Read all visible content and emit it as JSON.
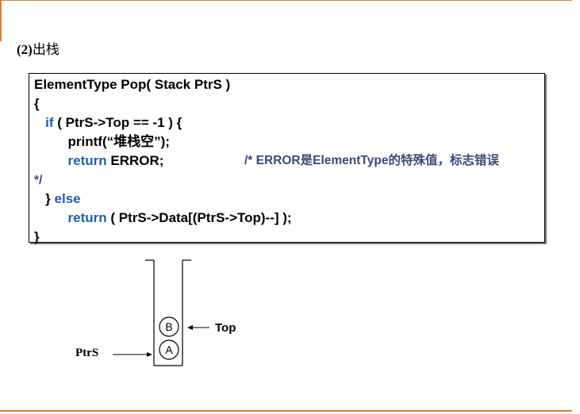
{
  "heading": {
    "number": "(2)",
    "text": "出栈"
  },
  "code": {
    "line1": "ElementType Pop( Stack PtrS )",
    "line2": "{",
    "line3_kw": "if",
    "line3_rest": " ( PtrS->Top == -1 ) {",
    "line4": "printf(“堆栈空”);",
    "line5_kw": "return",
    "line5_rest": " ERROR;",
    "line5_comment": "/* ERROR是ElementType的特殊值，标志错误",
    "line6": "*/",
    "line7_brace": "} ",
    "line7_kw": "else",
    "line8_kw": "return",
    "line8_rest": " ( PtrS->Data[(PtrS->Top)--] );",
    "line9": "}"
  },
  "diagram": {
    "top_label": "Top",
    "ptrs_label": "PtrS",
    "nodes": [
      "B",
      "A"
    ]
  }
}
